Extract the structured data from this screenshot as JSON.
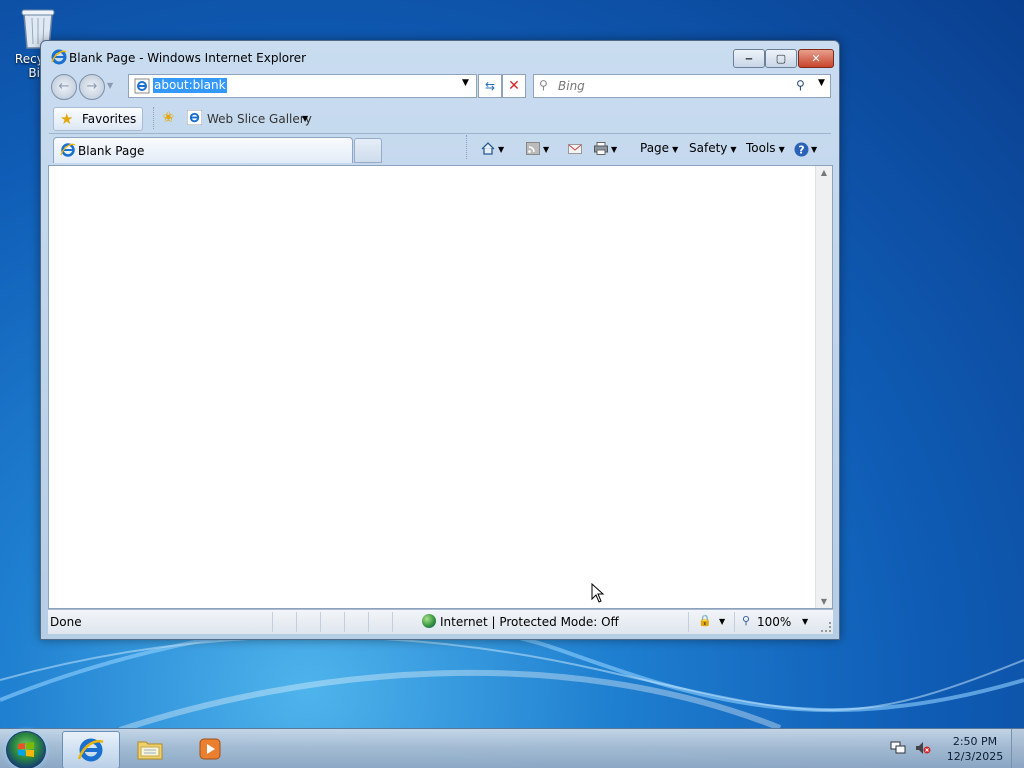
{
  "desktop": {
    "recycle_bin_label": "Recycle Bin"
  },
  "window": {
    "title": "Blank Page - Windows Internet Explorer",
    "minimize_glyph": "‒",
    "maximize_glyph": "▢",
    "close_glyph": "✕"
  },
  "navigation": {
    "back_glyph": "←",
    "forward_glyph": "→",
    "address_value": "about:blank",
    "search_placeholder": "Bing"
  },
  "favorites_bar": {
    "favorites_label": "Favorites",
    "web_slice_label": "Web Slice Gallery"
  },
  "tabs": [
    {
      "label": "Blank Page"
    }
  ],
  "command_bar": {
    "page_label": "Page",
    "safety_label": "Safety",
    "tools_label": "Tools"
  },
  "status_bar": {
    "status_text": "Done",
    "zone_text": "Internet | Protected Mode: Off",
    "zoom_text": "100%"
  },
  "taskbar": {
    "time": "2:50 PM",
    "date": "12/3/2025"
  },
  "colors": {
    "selection": "#3399ff",
    "close_button": "#c7442c",
    "stop": "#d42525",
    "favorites_star": "#e2a80f"
  }
}
